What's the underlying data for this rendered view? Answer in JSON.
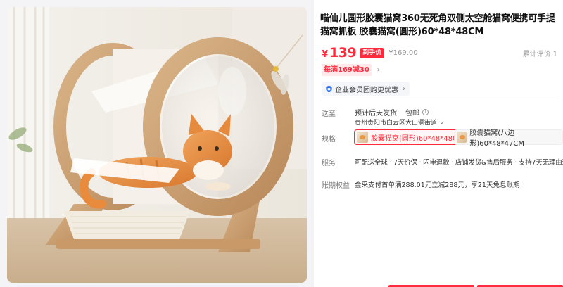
{
  "product": {
    "title": "喵仙儿圆形胶囊猫窝360无死角双侧太空舱猫窝便携可手提猫窝抓板 胶囊猫窝(圆形)60*48*48CM",
    "image_alt": "猫窝产品图"
  },
  "price": {
    "currency": "¥",
    "value": "139",
    "badge": "到手价",
    "original": "¥169.00",
    "reviews": "累计评价 1"
  },
  "promo": {
    "tag": "每满169减30",
    "arrow": "›"
  },
  "vip": {
    "label": "企业会员团购更优惠",
    "arrow": "›"
  },
  "shipping": {
    "label": "送至",
    "estimate": "预计后天发货",
    "free": "包邮",
    "info": "i",
    "address": "贵州贵阳市白云区大山洞街道",
    "address_arrow": "⌄"
  },
  "spec": {
    "label": "规格",
    "options": [
      {
        "name": "胶囊猫窝(圆形)60*48*48CM",
        "selected": true
      },
      {
        "name": "胶囊猫窝(八边形)60*48*47CM",
        "selected": false
      }
    ]
  },
  "service": {
    "label": "服务",
    "text": "可配送全球 · 7天价保 · 闪电退款 · 店铺发货&售后服务 · 支持7天无理由退货"
  },
  "payment": {
    "label": "账期权益",
    "text": "金采支付首单满288.01元立减288元，享21天免息账期"
  },
  "colors": {
    "accent": "#ff2a3c",
    "promo_bg": "#ffe9ea"
  }
}
